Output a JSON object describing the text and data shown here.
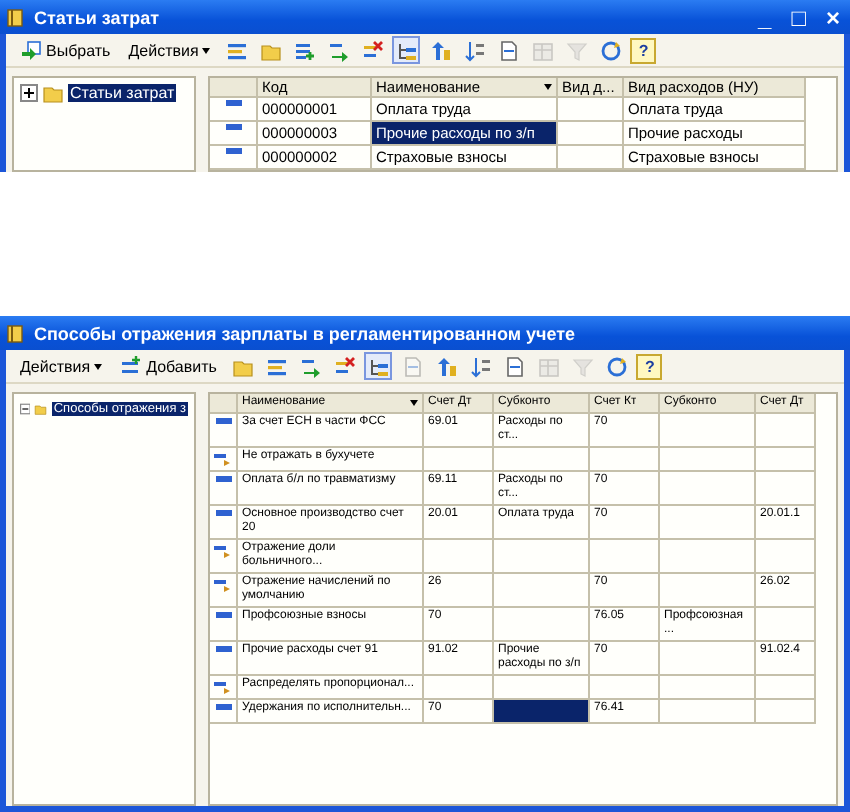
{
  "expense_items_window": {
    "title": "Статьи затрат",
    "controls": [
      "_",
      "□",
      "×"
    ],
    "toolbar": [
      {
        "kind": "button",
        "label": "Выбрать"
      },
      {
        "kind": "menu",
        "label": "Действия"
      },
      {
        "kind": "icon",
        "disabled": false,
        "pressed": false
      },
      {
        "kind": "icon",
        "disabled": false,
        "pressed": false
      },
      {
        "kind": "icon",
        "disabled": false,
        "pressed": false
      },
      {
        "kind": "icon",
        "disabled": false,
        "pressed": false
      },
      {
        "kind": "icon",
        "disabled": false,
        "pressed": false
      },
      {
        "kind": "icon",
        "disabled": false,
        "pressed": true
      },
      {
        "kind": "icon",
        "disabled": false,
        "pressed": false
      },
      {
        "kind": "icon",
        "disabled": false,
        "pressed": false
      },
      {
        "kind": "icon",
        "disabled": false,
        "pressed": false
      },
      {
        "kind": "icon",
        "disabled": true,
        "pressed": false
      },
      {
        "kind": "icon",
        "disabled": true,
        "pressed": false
      },
      {
        "kind": "icon",
        "disabled": false,
        "pressed": false
      },
      {
        "kind": "help",
        "label": "?"
      }
    ],
    "tree": {
      "label": "Статьи затрат",
      "expanded": false,
      "selected": true
    },
    "table": {
      "columns": [
        {
          "label": "Код",
          "sorted": false
        },
        {
          "label": "Наименование",
          "sorted": true
        },
        {
          "label": "Вид д...",
          "sorted": false
        },
        {
          "label": "Вид расходов (НУ)",
          "sorted": false
        }
      ],
      "rows": [
        {
          "kind": "entry",
          "cells": [
            {
              "text": "000000001",
              "selected": false
            },
            {
              "text": "Оплата труда",
              "selected": false
            },
            {
              "selected": false
            },
            {
              "text": "Оплата труда",
              "selected": false
            }
          ]
        },
        {
          "kind": "entry",
          "cells": [
            {
              "text": "000000003",
              "selected": false
            },
            {
              "text": "Прочие расходы по з/п",
              "selected": true
            },
            {
              "selected": false
            },
            {
              "text": "Прочие расходы",
              "selected": false
            }
          ]
        },
        {
          "kind": "entry",
          "cells": [
            {
              "text": "000000002",
              "selected": false
            },
            {
              "text": "Страховые взносы",
              "selected": false
            },
            {
              "selected": false
            },
            {
              "text": "Страховые взносы",
              "selected": false
            }
          ]
        }
      ]
    }
  },
  "salary_methods_window": {
    "title": "Способы отражения зарплаты в регламентированном учете",
    "toolbar": [
      {
        "kind": "menu",
        "label": "Действия"
      },
      {
        "kind": "button",
        "label": "Добавить"
      },
      {
        "kind": "icon",
        "disabled": false,
        "pressed": false
      },
      {
        "kind": "icon",
        "disabled": false,
        "pressed": false
      },
      {
        "kind": "icon",
        "disabled": false,
        "pressed": false
      },
      {
        "kind": "icon",
        "disabled": false,
        "pressed": false
      },
      {
        "kind": "icon",
        "disabled": false,
        "pressed": true
      },
      {
        "kind": "icon",
        "disabled": true,
        "pressed": false
      },
      {
        "kind": "icon",
        "disabled": false,
        "pressed": false
      },
      {
        "kind": "icon",
        "disabled": false,
        "pressed": false
      },
      {
        "kind": "icon",
        "disabled": false,
        "pressed": false
      },
      {
        "kind": "icon",
        "disabled": true,
        "pressed": false
      },
      {
        "kind": "icon",
        "disabled": true,
        "pressed": false
      },
      {
        "kind": "icon",
        "disabled": false,
        "pressed": false
      },
      {
        "kind": "help",
        "label": "?"
      }
    ],
    "tree": {
      "label": "Способы отражения з",
      "expanded": true,
      "selected": true
    },
    "table": {
      "columns": [
        {
          "label": "Наименование",
          "sorted": true
        },
        {
          "label": "Счет Дт",
          "sorted": false
        },
        {
          "label": "Субконто",
          "sorted": false
        },
        {
          "label": "Счет Кт",
          "sorted": false
        },
        {
          "label": "Субконто",
          "sorted": false
        },
        {
          "label": "Счет Дт",
          "sorted": false
        }
      ],
      "rows": [
        {
          "kind": "posting",
          "cells": [
            {
              "text": "За счет ЕСН в части ФСС",
              "selected": false
            },
            {
              "text": "69.01",
              "selected": false
            },
            {
              "text": "Расходы по ст...",
              "selected": false
            },
            {
              "text": "70",
              "selected": false
            },
            {
              "selected": false
            },
            {
              "selected": false
            }
          ]
        },
        {
          "kind": "skip",
          "cells": [
            {
              "text": "Не отражать в бухучете",
              "selected": false
            },
            {
              "selected": false
            },
            {
              "selected": false
            },
            {
              "selected": false
            },
            {
              "selected": false
            },
            {
              "selected": false
            }
          ]
        },
        {
          "kind": "posting",
          "cells": [
            {
              "text": "Оплата б/л по травматизму",
              "selected": false
            },
            {
              "text": "69.11",
              "selected": false
            },
            {
              "text": "Расходы по ст...",
              "selected": false
            },
            {
              "text": "70",
              "selected": false
            },
            {
              "selected": false
            },
            {
              "selected": false
            }
          ]
        },
        {
          "kind": "posting",
          "cells": [
            {
              "text": "Основное производство счет 20",
              "selected": false
            },
            {
              "text": "20.01",
              "selected": false
            },
            {
              "text": "Оплата труда",
              "selected": false
            },
            {
              "text": "70",
              "selected": false
            },
            {
              "selected": false
            },
            {
              "text": "20.01.1",
              "selected": false
            }
          ]
        },
        {
          "kind": "skip",
          "cells": [
            {
              "text": "Отражение доли больничного...",
              "selected": false
            },
            {
              "selected": false
            },
            {
              "selected": false
            },
            {
              "selected": false
            },
            {
              "selected": false
            },
            {
              "selected": false
            }
          ]
        },
        {
          "kind": "skip",
          "cells": [
            {
              "text": "Отражение начислений по умолчанию",
              "selected": false
            },
            {
              "text": "26",
              "selected": false
            },
            {
              "selected": false
            },
            {
              "text": "70",
              "selected": false
            },
            {
              "selected": false
            },
            {
              "text": "26.02",
              "selected": false
            }
          ]
        },
        {
          "kind": "posting",
          "cells": [
            {
              "text": "Профсоюзные взносы",
              "selected": false
            },
            {
              "text": "70",
              "selected": false
            },
            {
              "selected": false
            },
            {
              "text": "76.05",
              "selected": false
            },
            {
              "text": "Профсоюзная ...",
              "selected": false
            },
            {
              "selected": false
            }
          ]
        },
        {
          "kind": "posting",
          "cells": [
            {
              "text": "Прочие расходы счет 91",
              "selected": false
            },
            {
              "text": "91.02",
              "selected": false
            },
            {
              "text": "Прочие расходы по з/п",
              "selected": false
            },
            {
              "text": "70",
              "selected": false
            },
            {
              "selected": false
            },
            {
              "text": "91.02.4",
              "selected": false
            }
          ]
        },
        {
          "kind": "skip",
          "cells": [
            {
              "text": "Распределять пропорционал...",
              "selected": false
            },
            {
              "selected": false
            },
            {
              "selected": false
            },
            {
              "selected": false
            },
            {
              "selected": false
            },
            {
              "selected": false
            }
          ]
        },
        {
          "kind": "posting",
          "cells": [
            {
              "text": "Удержания по исполнительн...",
              "selected": false
            },
            {
              "text": "70",
              "selected": false
            },
            {
              "selected": true
            },
            {
              "text": "76.41",
              "selected": false
            },
            {
              "selected": false
            },
            {
              "selected": false
            }
          ]
        }
      ]
    }
  }
}
